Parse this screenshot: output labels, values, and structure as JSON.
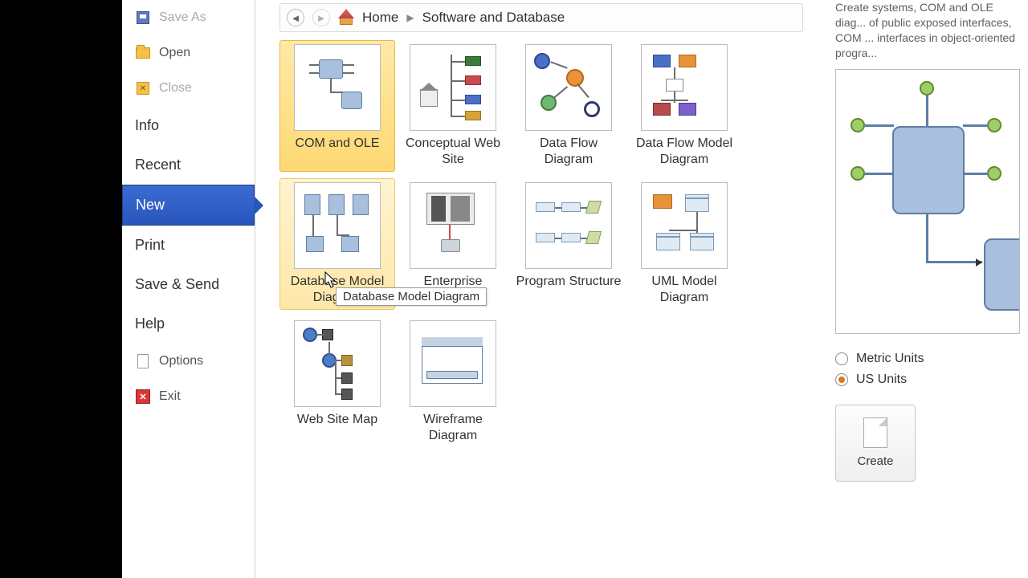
{
  "sidebar": {
    "save_as": "Save As",
    "open": "Open",
    "close": "Close",
    "info": "Info",
    "recent": "Recent",
    "new": "New",
    "print": "Print",
    "save_send": "Save & Send",
    "help": "Help",
    "options": "Options",
    "exit": "Exit"
  },
  "breadcrumb": {
    "home": "Home",
    "category": "Software and Database"
  },
  "templates": [
    {
      "label": "COM and OLE"
    },
    {
      "label": "Conceptual Web Site"
    },
    {
      "label": "Data Flow Diagram"
    },
    {
      "label": "Data Flow Model Diagram"
    },
    {
      "label": "Database Model Diagram"
    },
    {
      "label": "Enterprise Application"
    },
    {
      "label": "Program Structure"
    },
    {
      "label": "UML Model Diagram"
    },
    {
      "label": "Web Site Map"
    },
    {
      "label": "Wireframe Diagram"
    }
  ],
  "tooltip": "Database Model Diagram",
  "description": "Create systems, COM and OLE diag... of public exposed interfaces, COM ... interfaces in object-oriented progra...",
  "units": {
    "metric": "Metric Units",
    "us": "US Units"
  },
  "create_label": "Create"
}
